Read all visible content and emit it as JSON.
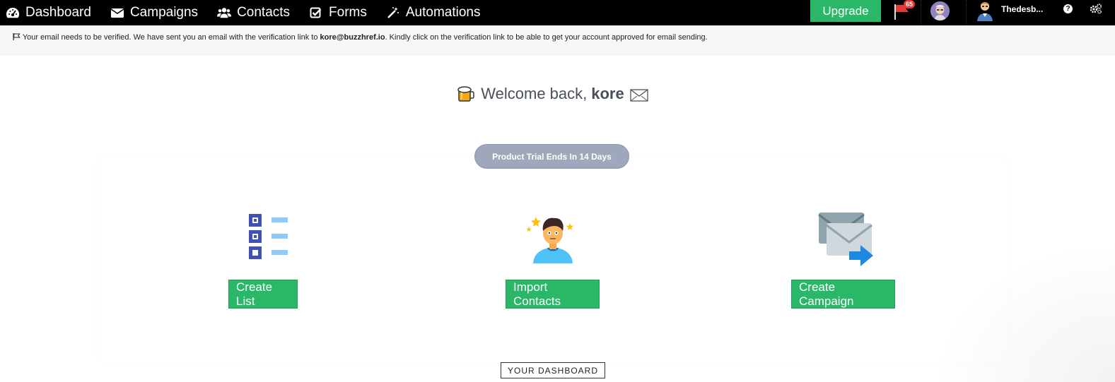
{
  "nav": {
    "items": [
      {
        "label": "Dashboard",
        "icon": "dashboard-gauge-icon"
      },
      {
        "label": "Campaigns",
        "icon": "envelope-icon"
      },
      {
        "label": "Contacts",
        "icon": "users-icon"
      },
      {
        "label": "Forms",
        "icon": "checkbox-icon"
      },
      {
        "label": "Automations",
        "icon": "magic-wand-icon"
      }
    ],
    "upgrade_label": "Upgrade",
    "notification_count": "65",
    "username": "Thedesb...",
    "help_label": "?"
  },
  "notice": {
    "prefix": "Your email needs to be verified. We have sent you an email with the verification link to ",
    "email": "kore@buzzhref.io",
    "suffix": ". Kindly click on the verification link to be able to get your account approved for email sending."
  },
  "welcome": {
    "text": "Welcome back,",
    "name": "kore"
  },
  "trial": {
    "label": "Product Trial Ends In 14 Days"
  },
  "actions": [
    {
      "label": "Create List"
    },
    {
      "label": "Import Contacts"
    },
    {
      "label": "Create Campaign"
    }
  ],
  "dashboard_label": "YOUR DASHBOARD",
  "colors": {
    "accent_green": "#2ab868",
    "nav_bg": "#000000",
    "pill": "#9fa7bc"
  }
}
